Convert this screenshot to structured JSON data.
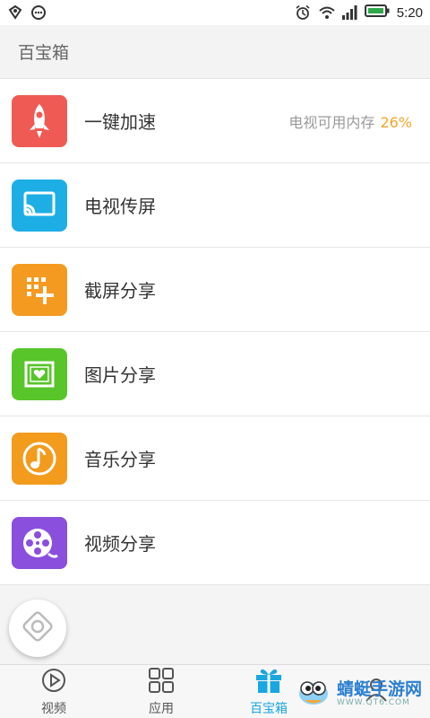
{
  "status_bar": {
    "time": "5:20"
  },
  "header": {
    "title": "百宝箱"
  },
  "items": [
    {
      "label": "一键加速",
      "icon": "rocket-icon",
      "color": "#f05a54",
      "extra_label": "电视可用内存",
      "extra_value": "26%"
    },
    {
      "label": "电视传屏",
      "icon": "cast-screen-icon",
      "color": "#1eaee6"
    },
    {
      "label": "截屏分享",
      "icon": "screenshot-grid-plus-icon",
      "color": "#f59a20"
    },
    {
      "label": "图片分享",
      "icon": "picture-heart-icon",
      "color": "#58c52a"
    },
    {
      "label": "音乐分享",
      "icon": "music-note-icon",
      "color": "#f39b1c"
    },
    {
      "label": "视频分享",
      "icon": "film-reel-icon",
      "color": "#8a4fdc"
    }
  ],
  "tabs": [
    {
      "label": "视频",
      "icon": "play-circle-icon",
      "active": false
    },
    {
      "label": "应用",
      "icon": "app-grid-icon",
      "active": false
    },
    {
      "label": "百宝箱",
      "icon": "gift-box-icon",
      "active": true
    },
    {
      "label": "",
      "icon": "user-icon",
      "active": false
    }
  ],
  "watermark": {
    "text": "蜻蜓手游网",
    "url": "WWW.QT6.COM"
  },
  "colors": {
    "accent": "#1aa6e0",
    "percent": "#f2a52a"
  }
}
